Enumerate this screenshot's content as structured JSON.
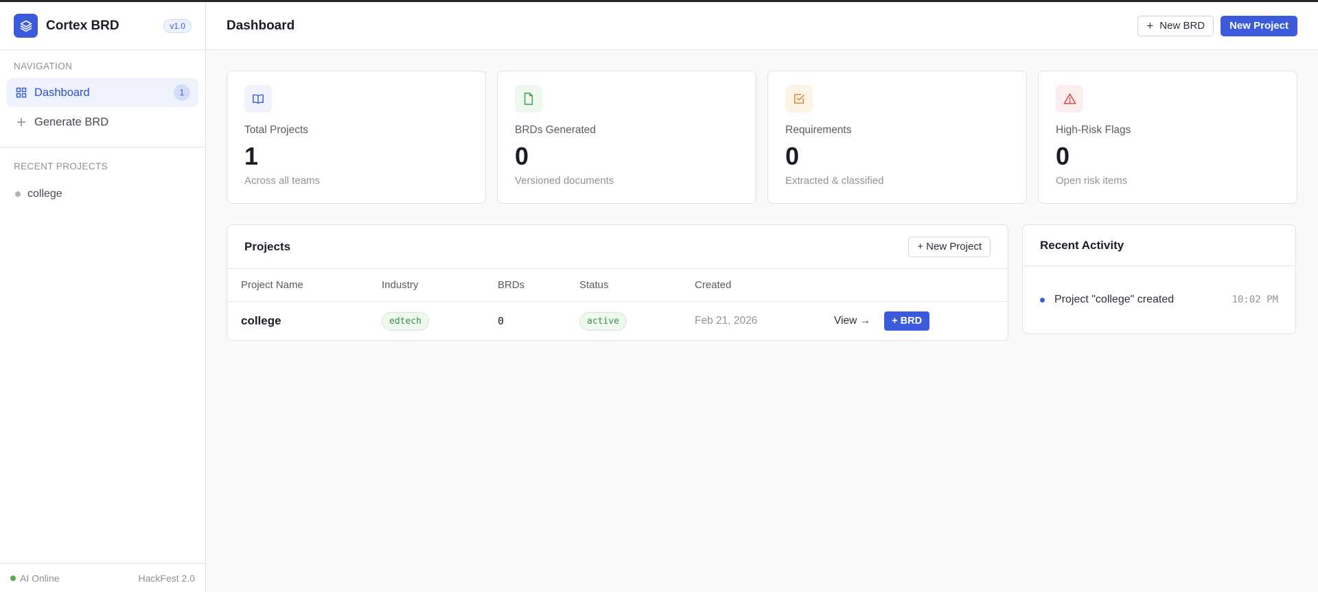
{
  "sidebar": {
    "brand": {
      "name": "Cortex BRD",
      "version": "v1.0"
    },
    "nav_title": "NAVIGATION",
    "nav_items": [
      {
        "label": "Dashboard",
        "icon": "grid-icon",
        "count": "1",
        "active": true
      },
      {
        "label": "Generate BRD",
        "icon": "plus-icon"
      }
    ],
    "recent_title": "RECENT PROJECTS",
    "recent_projects": [
      {
        "name": "college"
      }
    ],
    "footer": {
      "status": "AI Online",
      "event": "HackFest 2.0"
    }
  },
  "topbar": {
    "title": "Dashboard",
    "new_brd_label": "New BRD",
    "new_project_label": "New Project"
  },
  "stats": [
    {
      "label": "Total Projects",
      "value": "1",
      "sub": "Across all teams",
      "icon": "book-icon",
      "color": "#3b5bdb",
      "bg": "#eef2fd"
    },
    {
      "label": "BRDs Generated",
      "value": "0",
      "sub": "Versioned documents",
      "icon": "file-icon",
      "color": "#3d9a4c",
      "bg": "#eef8ef"
    },
    {
      "label": "Requirements",
      "value": "0",
      "sub": "Extracted & classified",
      "icon": "checkbox-icon",
      "color": "#d9822b",
      "bg": "#fdf4e8"
    },
    {
      "label": "High-Risk Flags",
      "value": "0",
      "sub": "Open risk items",
      "icon": "warning-icon",
      "color": "#d43b3b",
      "bg": "#fdeeee"
    }
  ],
  "projects": {
    "title": "Projects",
    "new_button": "+ New Project",
    "columns": [
      "Project Name",
      "Industry",
      "BRDs",
      "Status",
      "Created"
    ],
    "rows": [
      {
        "name": "college",
        "industry": "edtech",
        "brds": "0",
        "status": "active",
        "created": "Feb 21, 2026",
        "view": "View →",
        "brd_button": "+ BRD"
      }
    ]
  },
  "activity": {
    "title": "Recent Activity",
    "items": [
      {
        "text": "Project \"college\" created",
        "time": "10:02 PM"
      }
    ]
  },
  "colors": {
    "accent": "#3b5bdb",
    "online": "#4caf50"
  }
}
